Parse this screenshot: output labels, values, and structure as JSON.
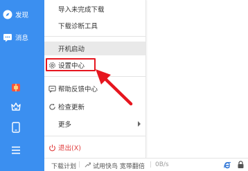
{
  "sidebar": {
    "items": [
      {
        "label": "发现",
        "icon": "compass-icon"
      },
      {
        "label": "消息",
        "icon": "chat-icon"
      }
    ],
    "buttons": [
      "gift-icon",
      "crown-icon",
      "phone-icon",
      "menu-icon"
    ]
  },
  "menu": {
    "items": {
      "import": "导入未完成下载",
      "diagnose": "下载诊断工具",
      "autostart": "开机启动",
      "settings": "设置中心",
      "feedback": "帮助反馈中心",
      "update": "检查更新",
      "more": "更多",
      "exit": "退出(X)"
    }
  },
  "statusbar": {
    "plan": "下载计划",
    "trial": "试用快鸟 宽带翻倍",
    "speed": "0B/s"
  },
  "colors": {
    "sidebar": "#3b8ff0",
    "highlight": "#e9e9e9",
    "annotation": "#e6161f"
  }
}
